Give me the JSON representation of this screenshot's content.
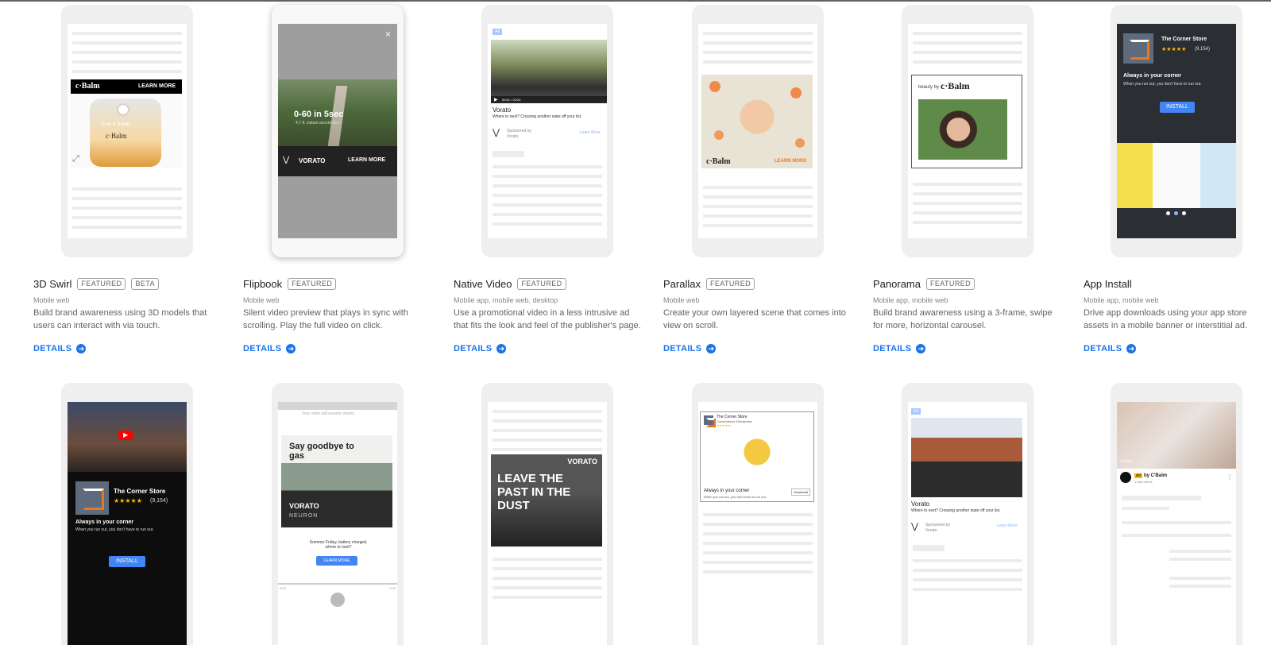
{
  "cards": [
    {
      "title": "3D Swirl",
      "badges": [
        "FEATURED",
        "BETA"
      ],
      "platforms": "Mobile web",
      "description": "Build brand awareness using 3D models that users can interact with via touch.",
      "details": "DETAILS"
    },
    {
      "title": "Flipbook",
      "badges": [
        "FEATURED"
      ],
      "platforms": "Mobile web",
      "description": "Silent video preview that plays in sync with scrolling. Play the full video on click.",
      "details": "DETAILS"
    },
    {
      "title": "Native Video",
      "badges": [
        "FEATURED"
      ],
      "platforms": "Mobile app, mobile web, desktop",
      "description": "Use a promotional video in a less intrusive ad that fits the look and feel of the publisher's page.",
      "details": "DETAILS"
    },
    {
      "title": "Parallax",
      "badges": [
        "FEATURED"
      ],
      "platforms": "Mobile web",
      "description": "Create your own layered scene that comes into view on scroll.",
      "details": "DETAILS"
    },
    {
      "title": "Panorama",
      "badges": [
        "FEATURED"
      ],
      "platforms": "Mobile app, mobile web",
      "description": "Build brand awareness using a 3-frame, swipe for more, horizontal carousel.",
      "details": "DETAILS"
    },
    {
      "title": "App Install",
      "badges": [],
      "platforms": "Mobile app, mobile web",
      "description": "Drive app downloads using your app store assets in a mobile banner or interstitial ad.",
      "details": "DETAILS"
    }
  ],
  "previews": {
    "swirl": {
      "brand": "c·Balm",
      "cta": "LEARN MORE",
      "product_brand": "c·Balm",
      "product_line": "Drop & Rotate"
    },
    "flipbook": {
      "headline": "0-60 in 5sec",
      "subline": "4.7 ft. instant acceleration",
      "brand": "VORATO",
      "cta": "LEARN MORE",
      "close": "×"
    },
    "native_video": {
      "time": "00:01 / 00:23",
      "title": "Vorato",
      "subtitle": "Where to next? Crossing another state off your list.",
      "sponsored": "Sponsored by",
      "sponsor": "Vorato",
      "cta": "Learn More",
      "ad_tag": "Ad"
    },
    "parallax": {
      "brand": "c·Balm",
      "cta": "LEARN MORE"
    },
    "panorama": {
      "prefix": "beauty by",
      "brand": "c·Balm"
    },
    "app_install": {
      "store": "The Corner Store",
      "rating_stars": "★★★★★",
      "rating_count": "(9,154)",
      "headline": "Always in your corner",
      "tagline": "When you run out, you don't have to run out.",
      "cta": "INSTALL"
    },
    "row2_install": {
      "store": "The Corner Store",
      "rating_stars": "★★★★★",
      "rating_count": "(9,154)",
      "headline": "Always in your corner",
      "tagline": "When you run out, you don't have to run out.",
      "cta": "INSTALL"
    },
    "row2_gas": {
      "banner": "Your video will resume shortly",
      "headline": "Say goodbye to gas",
      "brand": "VORATO",
      "model": "NEURON",
      "copy": "Summer Friday, battery charged, where to next?",
      "cta": "LEARN MORE",
      "time_start": "0:00",
      "time_end": "0:23"
    },
    "row2_dust": {
      "brand": "VORATO",
      "headline": "LEAVE THE PAST IN THE DUST"
    },
    "row2_store": {
      "store": "The Corner Store",
      "store_sub": "Convenience Enterprises",
      "stars": "★★★★★",
      "headline": "Always in your corner",
      "tagline": "When you run out, you don't have to run out.",
      "cta": "Download"
    },
    "row2_native": {
      "ad_tag": "Ad",
      "title": "Vorato",
      "subtitle": "Where to next? Crossing another state off your list.",
      "sponsored": "Sponsored by",
      "sponsor": "Vorato",
      "cta": "Learn More"
    },
    "row2_youtube": {
      "ad_tag": "Ad",
      "channel": "by C'Balm",
      "views": "1,968 videos",
      "watermark": "c·Balm"
    }
  },
  "colors": {
    "accent": "#1a73e8",
    "badge_border": "#9aa0a6",
    "phone_bg": "#efefef"
  }
}
